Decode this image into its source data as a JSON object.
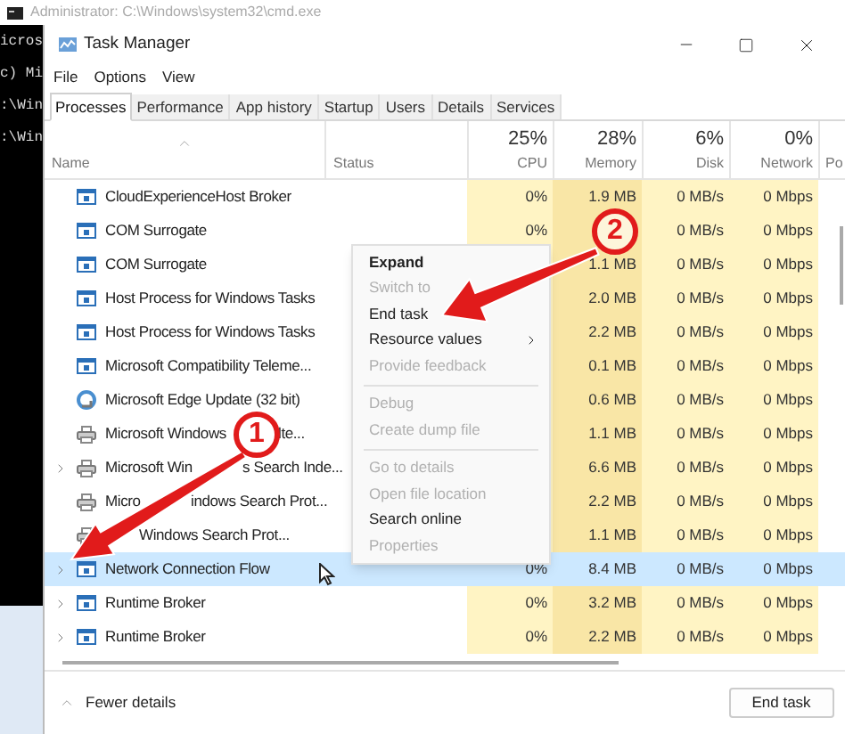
{
  "console": {
    "title": "Administrator: C:\\Windows\\system32\\cmd.exe",
    "lines": [
      "icros",
      "c) Mi",
      ":\\Win",
      ":\\Win"
    ]
  },
  "window": {
    "title": "Task Manager"
  },
  "menu": [
    "File",
    "Options",
    "View"
  ],
  "tabs": [
    {
      "label": "Processes",
      "selected": true
    },
    {
      "label": "Performance",
      "selected": false
    },
    {
      "label": "App history",
      "selected": false
    },
    {
      "label": "Startup",
      "selected": false
    },
    {
      "label": "Users",
      "selected": false
    },
    {
      "label": "Details",
      "selected": false
    },
    {
      "label": "Services",
      "selected": false
    }
  ],
  "columns": [
    {
      "label": "Name"
    },
    {
      "label": "Status"
    },
    {
      "label": "CPU",
      "usage": "25%"
    },
    {
      "label": "Memory",
      "usage": "28%"
    },
    {
      "label": "Disk",
      "usage": "6%"
    },
    {
      "label": "Network",
      "usage": "0%"
    },
    {
      "label": "Po"
    }
  ],
  "rows": [
    {
      "name": "CloudExperienceHost Broker",
      "kind": "window",
      "expandable": false,
      "selected": false,
      "cpu": "0%",
      "memory": "1.9 MB",
      "disk": "0 MB/s",
      "network": "0 Mbps"
    },
    {
      "name": "COM Surrogate",
      "kind": "window",
      "expandable": false,
      "selected": false,
      "cpu": "0%",
      "disk": "0 MB/s",
      "network": "0 Mbps"
    },
    {
      "name": "COM Surrogate",
      "kind": "window",
      "expandable": false,
      "selected": false,
      "memory": "1.1 MB",
      "disk": "0 MB/s",
      "network": "0 Mbps"
    },
    {
      "name": "Host Process for Windows Tasks",
      "kind": "window",
      "expandable": false,
      "selected": false,
      "memory": "2.0 MB",
      "disk": "0 MB/s",
      "network": "0 Mbps"
    },
    {
      "name": "Host Process for Windows Tasks",
      "kind": "window",
      "expandable": false,
      "selected": false,
      "memory": "2.2 MB",
      "disk": "0 MB/s",
      "network": "0 Mbps"
    },
    {
      "name": "Microsoft Compatibility Teleme...",
      "kind": "window",
      "expandable": false,
      "selected": false,
      "memory": "0.1 MB",
      "disk": "0 MB/s",
      "network": "0 Mbps"
    },
    {
      "name": "Microsoft Edge Update (32 bit)",
      "kind": "swirl",
      "expandable": false,
      "selected": false,
      "memory": "0.6 MB",
      "disk": "0 MB/s",
      "network": "0 Mbps"
    },
    {
      "name": "Microsoft Windows",
      "name_rest": "lte...",
      "kind": "printer",
      "expandable": false,
      "selected": false,
      "memory": "1.1 MB",
      "disk": "0 MB/s",
      "network": "0 Mbps"
    },
    {
      "name": "Microsoft Win",
      "name_rest": "s Search Inde...",
      "kind": "printer",
      "expandable": true,
      "selected": false,
      "memory": "6.6 MB",
      "disk": "0 MB/s",
      "network": "0 Mbps"
    },
    {
      "name": "Micro",
      "name_rest": "indows Search Prot...",
      "kind": "printer",
      "expandable": false,
      "selected": false,
      "memory": "2.2 MB",
      "disk": "0 MB/s",
      "network": "0 Mbps"
    },
    {
      "name_rest": "Windows Search Prot...",
      "kind": "printer",
      "expandable": false,
      "selected": false,
      "memory": "1.1 MB",
      "disk": "0 MB/s",
      "network": "0 Mbps"
    },
    {
      "name": "Network Connection Flow",
      "kind": "window",
      "expandable": true,
      "selected": true,
      "cpu": "0%",
      "memory": "8.4 MB",
      "disk": "0 MB/s",
      "network": "0 Mbps"
    },
    {
      "name": "Runtime Broker",
      "kind": "window",
      "expandable": true,
      "selected": false,
      "cpu": "0%",
      "memory": "3.2 MB",
      "disk": "0 MB/s",
      "network": "0 Mbps"
    },
    {
      "name": "Runtime Broker",
      "kind": "window",
      "expandable": true,
      "selected": false,
      "cpu": "0%",
      "memory": "2.2 MB",
      "disk": "0 MB/s",
      "network": "0 Mbps"
    }
  ],
  "context_menu": [
    {
      "kind": "item",
      "label": "Expand",
      "default": true,
      "disabled": false,
      "submenu": false
    },
    {
      "kind": "item",
      "label": "Switch to",
      "default": false,
      "disabled": true,
      "submenu": false
    },
    {
      "kind": "item",
      "label": "End task",
      "default": false,
      "disabled": false,
      "submenu": false
    },
    {
      "kind": "item",
      "label": "Resource values",
      "default": false,
      "disabled": false,
      "submenu": true
    },
    {
      "kind": "item",
      "label": "Provide feedback",
      "default": false,
      "disabled": true,
      "submenu": false
    },
    {
      "kind": "separator"
    },
    {
      "kind": "item",
      "label": "Debug",
      "default": false,
      "disabled": true,
      "submenu": false
    },
    {
      "kind": "item",
      "label": "Create dump file",
      "default": false,
      "disabled": true,
      "submenu": false
    },
    {
      "kind": "separator"
    },
    {
      "kind": "item",
      "label": "Go to details",
      "default": false,
      "disabled": true,
      "submenu": false
    },
    {
      "kind": "item",
      "label": "Open file location",
      "default": false,
      "disabled": true,
      "submenu": false
    },
    {
      "kind": "item",
      "label": "Search online",
      "default": false,
      "disabled": false,
      "submenu": false
    },
    {
      "kind": "item",
      "label": "Properties",
      "default": false,
      "disabled": true,
      "submenu": false
    }
  ],
  "annotations": [
    {
      "label": "1"
    },
    {
      "label": "2"
    }
  ],
  "footer": {
    "toggle": "Fewer details",
    "button": "End task"
  }
}
